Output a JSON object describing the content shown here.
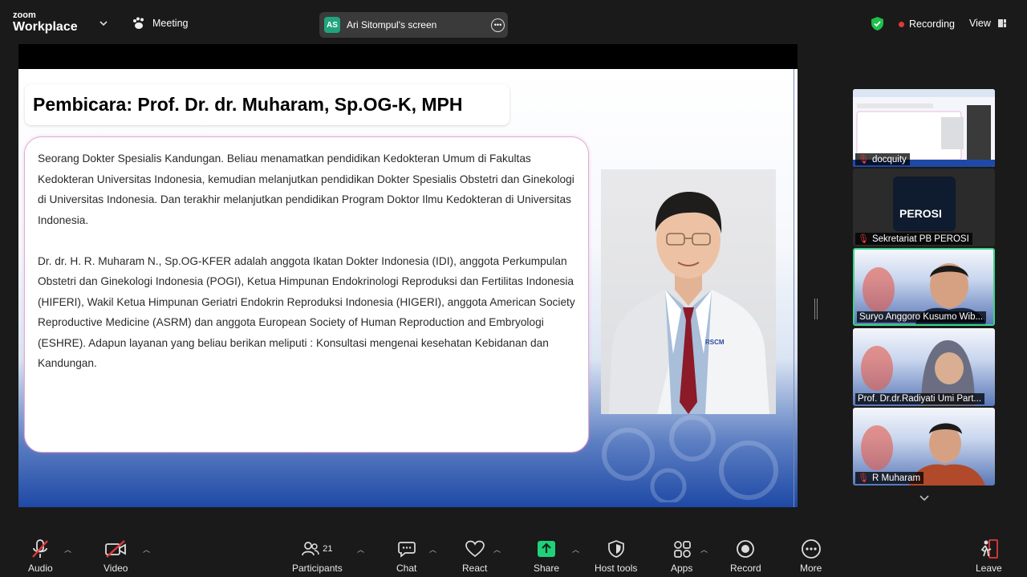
{
  "app": {
    "logo_line1": "zoom",
    "logo_line2": "Workplace"
  },
  "topbar": {
    "meeting_label": "Meeting",
    "share_initials": "AS",
    "share_label": "Ari Sitompul's screen",
    "recording_label": "Recording",
    "view_label": "View"
  },
  "slide": {
    "title": "Pembicara: Prof. Dr. dr. Muharam, Sp.OG-K, MPH",
    "para1": "Seorang Dokter Spesialis Kandungan. Beliau menamatkan pendidikan Kedokteran Umum di Fakultas Kedokteran Universitas Indonesia, kemudian melanjutkan pendidikan Dokter Spesialis Obstetri dan Ginekologi di Universitas Indonesia. Dan terakhir melanjutkan pendidikan Program Doktor Ilmu Kedokteran di Universitas Indonesia.",
    "para2": "Dr. dr. H. R. Muharam N., Sp.OG-KFER adalah anggota Ikatan Dokter Indonesia (IDI), anggota Perkumpulan Obstetri dan Ginekologi Indonesia (POGI), Ketua Himpunan Endokrinologi Reproduksi dan Fertilitas Indonesia (HIFERI), Wakil Ketua Himpunan Geriatri Endokrin Reproduksi Indonesia (HIGERI), anggota American Society Reproductive Medicine (ASRM) dan anggota European Society of Human Reproduction and Embryologi (ESHRE). Adapun layanan yang beliau berikan meliputi : Konsultasi mengenai kesehatan Kebidanan dan Kandungan.",
    "coat_label": "RSCM"
  },
  "participants": [
    {
      "name": "docquity"
    },
    {
      "name": "Sekretariat PB PEROSI",
      "logo_text": "PEROSI"
    },
    {
      "name": "Suryo Anggoro Kusumo Wib..."
    },
    {
      "name": "Prof. Dr.dr.Radiyati Umi Part..."
    },
    {
      "name": "R Muharam"
    }
  ],
  "toolbar": {
    "audio": "Audio",
    "video": "Video",
    "participants": "Participants",
    "participants_count": "21",
    "chat": "Chat",
    "react": "React",
    "share": "Share",
    "host_tools": "Host tools",
    "apps": "Apps",
    "record": "Record",
    "more": "More",
    "leave": "Leave"
  },
  "colors": {
    "accent_green": "#21a47c",
    "share_green": "#1fd27a",
    "recording_red": "#e5373a",
    "active_speaker": "#3bd48a"
  }
}
